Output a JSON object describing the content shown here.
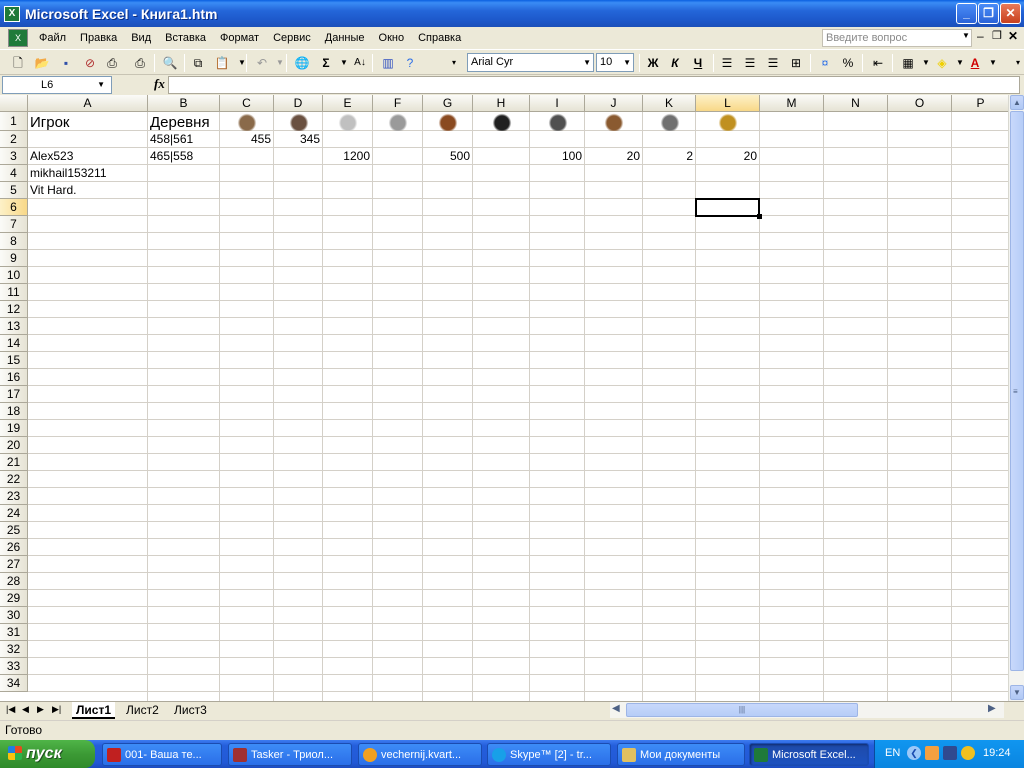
{
  "window": {
    "title": "Microsoft Excel - Книга1.htm",
    "app_icon": "X"
  },
  "menu": [
    {
      "label": "Файл"
    },
    {
      "label": "Правка"
    },
    {
      "label": "Вид"
    },
    {
      "label": "Вставка"
    },
    {
      "label": "Формат"
    },
    {
      "label": "Сервис"
    },
    {
      "label": "Данные"
    },
    {
      "label": "Окно"
    },
    {
      "label": "Справка"
    }
  ],
  "help_placeholder": "Введите вопрос",
  "toolbar": {
    "font_name": "Arial Cyr",
    "font_size": "10",
    "bold": "Ж",
    "italic": "К",
    "underline": "Ч",
    "percent": "%",
    "sigma": "Σ"
  },
  "formula": {
    "name_box": "L6",
    "fx": "fx",
    "content": ""
  },
  "columns": [
    "A",
    "B",
    "C",
    "D",
    "E",
    "F",
    "G",
    "H",
    "I",
    "J",
    "K",
    "L",
    "M",
    "N",
    "O",
    "P"
  ],
  "selected_column": "L",
  "selected_row": 6,
  "rows": [
    "1",
    "2",
    "3",
    "4",
    "5",
    "6",
    "7",
    "8",
    "9",
    "10",
    "11",
    "12",
    "13",
    "14",
    "15",
    "16",
    "17",
    "18",
    "19",
    "20",
    "21",
    "22",
    "23",
    "24",
    "25",
    "26",
    "27",
    "28",
    "29",
    "30",
    "31",
    "32",
    "33",
    "34"
  ],
  "cells": {
    "A1": "Игрок",
    "B1": "Деревня",
    "B2": "458|561",
    "C2": "455",
    "D2": "345",
    "A3": "Alex523",
    "B3": "465|558",
    "E3": "1200",
    "G3": "500",
    "I3": "100",
    "J3": "20",
    "K3": "2",
    "L3": "20",
    "A4": "mikhail153211",
    "A5": "Vit Hard."
  },
  "unit_icons": [
    "spear-icon",
    "axes-icon",
    "light-cavalry-icon",
    "scout-icon",
    "horse-archer-icon",
    "heavy-cavalry-icon",
    "ram-icon",
    "catapult-icon",
    "paladin-icon",
    "noble-icon"
  ],
  "sheets": [
    {
      "label": "Лист1",
      "active": true
    },
    {
      "label": "Лист2"
    },
    {
      "label": "Лист3"
    }
  ],
  "status": "Готово",
  "taskbar": {
    "start": "пуск",
    "tasks": [
      {
        "label": "001- Ваша те..."
      },
      {
        "label": "Tasker - Триол..."
      },
      {
        "label": "vechernij.kvart..."
      },
      {
        "label": "Skype™ [2] - tr..."
      },
      {
        "label": "Мои документы"
      },
      {
        "label": "Microsoft Excel..."
      }
    ],
    "lang": "EN",
    "clock": "19:24"
  }
}
